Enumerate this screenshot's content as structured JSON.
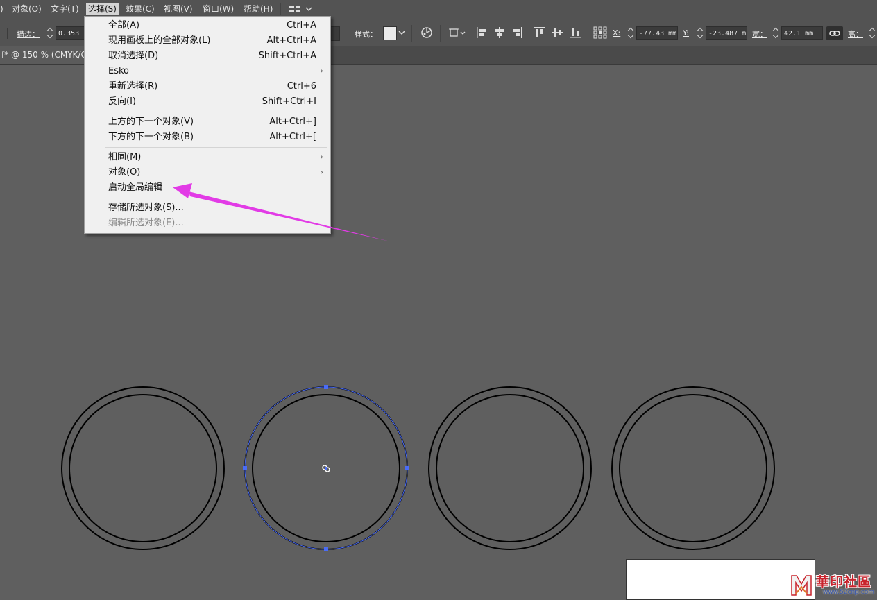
{
  "menubar": {
    "partial_left": ")",
    "items": [
      {
        "label": "对象(O)"
      },
      {
        "label": "文字(T)"
      },
      {
        "label": "选择(S)"
      },
      {
        "label": "效果(C)"
      },
      {
        "label": "视图(V)"
      },
      {
        "label": "窗口(W)"
      },
      {
        "label": "帮助(H)"
      }
    ],
    "workspace_icon": "layout-grid-icon"
  },
  "controlbar": {
    "stroke_label": "描边：",
    "stroke_value": "0.353",
    "style_label": "样式：",
    "x_label": "X:",
    "x_value": "-77.43 mm",
    "y_label": "Y:",
    "y_value": "-23.487 m",
    "width_label": "宽：",
    "width_value": "42.1 mm",
    "height_label": "高："
  },
  "document_tab": {
    "title": "f* @ 150 % (CMYK/C"
  },
  "select_menu": {
    "items": [
      {
        "label": "全部(A)",
        "shortcut": "Ctrl+A"
      },
      {
        "label": "现用画板上的全部对象(L)",
        "shortcut": "Alt+Ctrl+A"
      },
      {
        "label": "取消选择(D)",
        "shortcut": "Shift+Ctrl+A"
      },
      {
        "label": "Esko",
        "shortcut": "",
        "submenu": true
      },
      {
        "label": "重新选择(R)",
        "shortcut": "Ctrl+6"
      },
      {
        "label": "反向(I)",
        "shortcut": "Shift+Ctrl+I"
      },
      {
        "label": "上方的下一个对象(V)",
        "shortcut": "Alt+Ctrl+]"
      },
      {
        "label": "下方的下一个对象(B)",
        "shortcut": "Alt+Ctrl+["
      },
      {
        "label": "相同(M)",
        "shortcut": "",
        "submenu": true
      },
      {
        "label": "对象(O)",
        "shortcut": "",
        "submenu": true
      },
      {
        "label": "启动全局编辑",
        "shortcut": ""
      },
      {
        "label": "存储所选对象(S)...",
        "shortcut": ""
      },
      {
        "label": "编辑所选对象(E)...",
        "shortcut": "",
        "disabled": true
      }
    ]
  },
  "canvas": {
    "ring_count": 4,
    "selected_ring_index": 1
  },
  "colors": {
    "annotation_arrow": "#e23be6",
    "selection": "#4a6cf7"
  },
  "watermark": {
    "title": "華印社區",
    "url": "www.52cnp.com"
  }
}
